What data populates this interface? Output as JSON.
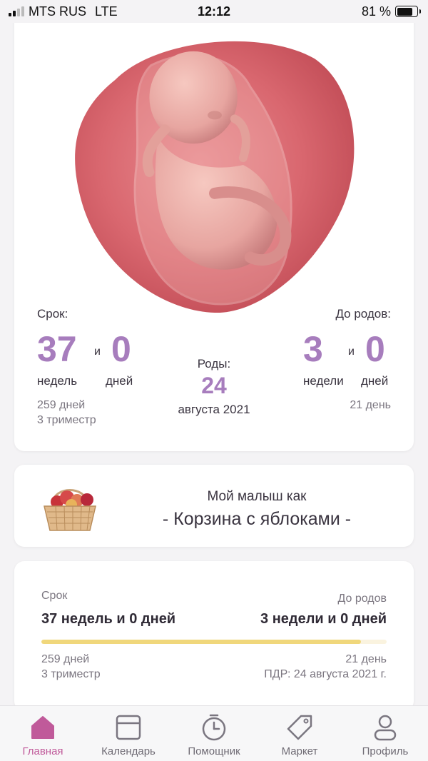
{
  "status": {
    "carrier": "MTS RUS",
    "network": "LTE",
    "time": "12:12",
    "battery": "81 %",
    "battery_level": 0.81
  },
  "pregnancy": {
    "term_label": "Срок:",
    "weeks": "37",
    "and": "и",
    "days": "0",
    "weeks_unit": "недель",
    "days_unit": "дней",
    "total_days": "259 дней",
    "trimester": "3 триместр",
    "birth_label": "Роды:",
    "birth_day": "24",
    "birth_month_year": "августа 2021",
    "until_label": "До родов:",
    "until_weeks": "3",
    "until_days": "0",
    "until_weeks_unit": "недели",
    "until_days_unit": "дней",
    "until_total_days": "21 день"
  },
  "baby": {
    "line1": "Мой малыш как",
    "line2": "- Корзина с яблоками -",
    "icon": "apple-basket"
  },
  "progress": {
    "term_label": "Срок",
    "term_value": "37 недель и 0 дней",
    "until_label": "До родов",
    "until_value": "3 недели и 0 дней",
    "fraction": 0.925,
    "total_days": "259 дней",
    "trimester": "3 триместр",
    "remaining_days": "21 день",
    "due_date": "ПДР: 24 августа 2021 г."
  },
  "tabs": [
    {
      "label": "Главная",
      "icon": "home-icon",
      "active": true
    },
    {
      "label": "Календарь",
      "icon": "calendar-icon",
      "active": false
    },
    {
      "label": "Помощник",
      "icon": "stopwatch-icon",
      "active": false
    },
    {
      "label": "Маркет",
      "icon": "tag-icon",
      "active": false
    },
    {
      "label": "Профиль",
      "icon": "profile-icon",
      "active": false
    }
  ],
  "colors": {
    "accent": "#a77dbd",
    "active_tab": "#c05a9a",
    "progress": "#f0d77b"
  }
}
